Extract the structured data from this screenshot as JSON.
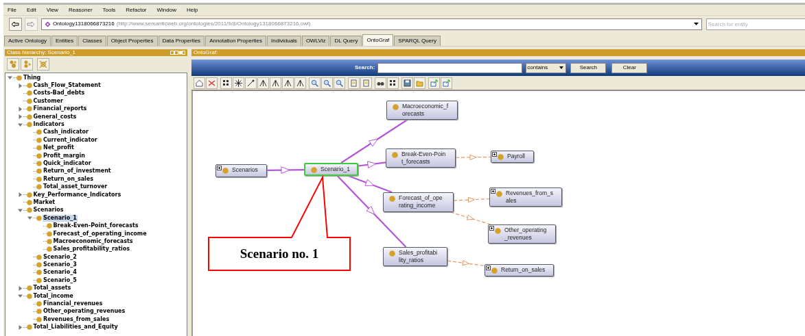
{
  "menu": [
    "File",
    "Edit",
    "View",
    "Reasoner",
    "Tools",
    "Refactor",
    "Window",
    "Help"
  ],
  "address": {
    "name": "Ontology1318066873216",
    "iri": "(http://www.semanticweb.org/ontologies/2011/9/8/Ontology1318066873216.owl)"
  },
  "entity_search": {
    "placeholder": "Search for entity"
  },
  "tabs": [
    {
      "label": "Active Ontology",
      "selected": false
    },
    {
      "label": "Entities",
      "selected": false
    },
    {
      "label": "Classes",
      "selected": false
    },
    {
      "label": "Object Properties",
      "selected": false
    },
    {
      "label": "Data Properties",
      "selected": false
    },
    {
      "label": "Annotation Properties",
      "selected": false
    },
    {
      "label": "Individuals",
      "selected": false
    },
    {
      "label": "OWLViz",
      "selected": false
    },
    {
      "label": "DL Query",
      "selected": false
    },
    {
      "label": "OntoGraf",
      "selected": true
    },
    {
      "label": "SPARQL Query",
      "selected": false
    }
  ],
  "class_hierarchy": {
    "title": "Class hierarchy: Scenario_1",
    "tree": [
      {
        "label": "Thing",
        "selected": false,
        "expanded": true,
        "children": [
          {
            "label": "Cash_Flow_Statement",
            "selected": false,
            "expanded": false
          },
          {
            "label": "Costs-Bad_debts",
            "selected": false
          },
          {
            "label": "Customer",
            "selected": false
          },
          {
            "label": "Financial_reports",
            "selected": false,
            "expanded": false
          },
          {
            "label": "General_costs",
            "selected": false,
            "expanded": false
          },
          {
            "label": "Indicators",
            "selected": false,
            "expanded": true,
            "children": [
              {
                "label": "Cash_indicator",
                "selected": false
              },
              {
                "label": "Current_indicator",
                "selected": false
              },
              {
                "label": "Net_profit",
                "selected": false
              },
              {
                "label": "Profit_margin",
                "selected": false
              },
              {
                "label": "Quick_indicator",
                "selected": false
              },
              {
                "label": "Return_of_investment",
                "selected": false
              },
              {
                "label": "Return_on_sales",
                "selected": false
              },
              {
                "label": "Total_asset_turnover",
                "selected": false
              }
            ]
          },
          {
            "label": "Key_Performance_Indicators",
            "selected": false,
            "expanded": false
          },
          {
            "label": "Market",
            "selected": false
          },
          {
            "label": "Scenarios",
            "selected": false,
            "expanded": true,
            "children": [
              {
                "label": "Scenario_1",
                "selected": true,
                "expanded": true,
                "children": [
                  {
                    "label": "Break-Even-Point_forecasts",
                    "selected": false
                  },
                  {
                    "label": "Forecast_of_operating_income",
                    "selected": false
                  },
                  {
                    "label": "Macroeconomic_forecasts",
                    "selected": false
                  },
                  {
                    "label": "Sales_profitability_ratios",
                    "selected": false
                  }
                ]
              },
              {
                "label": "Scenario_2",
                "selected": false
              },
              {
                "label": "Scenario_3",
                "selected": false
              },
              {
                "label": "Scenario_4",
                "selected": false
              },
              {
                "label": "Scenario_5",
                "selected": false
              }
            ]
          },
          {
            "label": "Total_assets",
            "selected": false,
            "expanded": false
          },
          {
            "label": "Total_income",
            "selected": false,
            "expanded": true,
            "children": [
              {
                "label": "Financial_revenues",
                "selected": false
              },
              {
                "label": "Other_operating_revenues",
                "selected": false
              },
              {
                "label": "Revenues_from_sales",
                "selected": false
              }
            ]
          },
          {
            "label": "Total_Liabilities_and_Equity",
            "selected": false,
            "expanded": false
          }
        ]
      }
    ]
  },
  "ontograf": {
    "title": "OntoGraf:",
    "search_label": "Search:",
    "match_mode": "contains",
    "buttons": [
      "Search",
      "Clear"
    ],
    "nodes": [
      {
        "lines": [
          "Scenarios"
        ],
        "expandable": true,
        "selected": false
      },
      {
        "lines": [
          "Scenario_1"
        ],
        "expandable": false,
        "selected": true,
        "incoming_dashed": false
      },
      {
        "lines": [
          "Macroeconomic_f",
          "orecasts"
        ],
        "expandable": false,
        "selected": false,
        "incoming_dashed": false
      },
      {
        "lines": [
          "Break-Even-Poin",
          "t_forecasts"
        ],
        "expandable": false,
        "selected": false,
        "incoming_dashed": false
      },
      {
        "lines": [
          "Forecast_of_ope",
          "rating_income"
        ],
        "expandable": false,
        "selected": false,
        "incoming_dashed": false
      },
      {
        "lines": [
          "Sales_profitabi",
          "lity_ratios"
        ],
        "expandable": false,
        "selected": false,
        "incoming_dashed": false
      },
      {
        "lines": [
          "Payroll"
        ],
        "expandable": true,
        "selected": false,
        "incoming_dashed": true
      },
      {
        "lines": [
          "Revenues_from_s",
          "ales"
        ],
        "expandable": true,
        "selected": false,
        "incoming_dashed": true
      },
      {
        "lines": [
          "Other_operating",
          "_revenues"
        ],
        "expandable": true,
        "selected": false,
        "incoming_dashed": true
      },
      {
        "lines": [
          "Return_on_sales"
        ],
        "expandable": true,
        "selected": false,
        "incoming_dashed": true
      }
    ],
    "callout": {
      "text": "Scenario no. 1"
    }
  }
}
